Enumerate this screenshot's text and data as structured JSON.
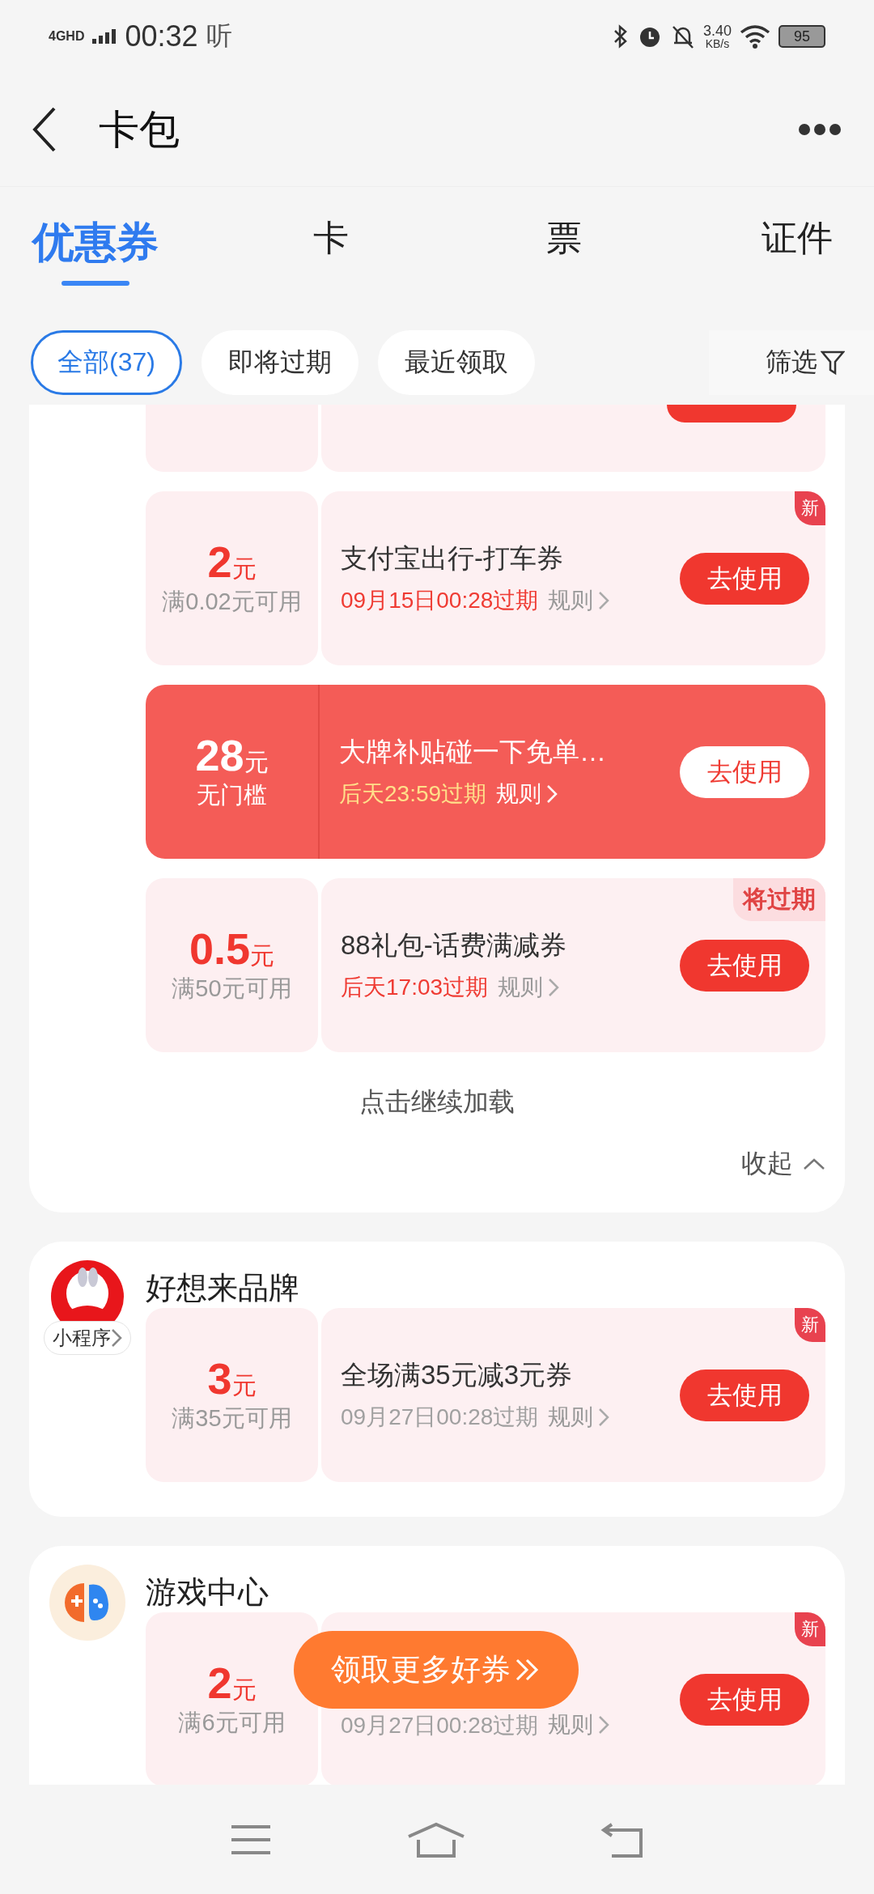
{
  "status_bar": {
    "network": "4GHD",
    "time": "00:32",
    "app_glyph": "听",
    "speed": "3.40",
    "speed_unit": "KB/s",
    "battery": "95"
  },
  "header": {
    "title": "卡包"
  },
  "tabs": [
    {
      "label": "优惠券",
      "selected": true
    },
    {
      "label": "卡",
      "selected": false
    },
    {
      "label": "票",
      "selected": false
    },
    {
      "label": "证件",
      "selected": false
    }
  ],
  "filters": [
    {
      "label": "全部(37)",
      "selected": true
    },
    {
      "label": "即将过期",
      "selected": false
    },
    {
      "label": "最近领取",
      "selected": false
    }
  ],
  "filter_button": "筛选",
  "groups": [
    {
      "coupons": [
        {
          "kind": "partial",
          "highlighted": false
        },
        {
          "kind": "full",
          "highlighted": false,
          "amount": "2",
          "unit": "元",
          "condition": "满0.02元可用",
          "title": "支付宝出行-打车券",
          "expiry": "09月15日00:28过期",
          "expiry_alert": true,
          "rule": "规则",
          "button": "去使用",
          "badge": {
            "kind": "new",
            "text": "新"
          }
        },
        {
          "kind": "full",
          "highlighted": true,
          "amount": "28",
          "unit": "元",
          "condition": "无门槛",
          "title": "大牌补贴碰一下免单…",
          "expiry": "后天23:59过期",
          "expiry_alert": true,
          "rule": "规则",
          "button": "去使用"
        },
        {
          "kind": "full",
          "highlighted": false,
          "amount": "0.5",
          "unit": "元",
          "condition": "满50元可用",
          "title": "88礼包-话费满减券",
          "expiry": "后天17:03过期",
          "expiry_alert": true,
          "rule": "规则",
          "button": "去使用",
          "badge": {
            "kind": "expiring",
            "text": "将过期"
          }
        }
      ],
      "load_more": "点击继续加载",
      "collapse": "收起"
    },
    {
      "brand": {
        "logo": {
          "kind": "rabbit"
        },
        "title": "好想来品牌",
        "tag": "小程序"
      },
      "coupons": [
        {
          "kind": "full",
          "highlighted": false,
          "amount": "3",
          "unit": "元",
          "condition": "满35元可用",
          "title": "全场满35元减3元券",
          "expiry": "09月27日00:28过期",
          "expiry_alert": false,
          "rule": "规则",
          "button": "去使用",
          "badge": {
            "kind": "new",
            "text": "新"
          }
        }
      ]
    },
    {
      "brand": {
        "logo": {
          "kind": "gamepad"
        },
        "title": "游戏中心"
      },
      "coupons": [
        {
          "kind": "full",
          "highlighted": false,
          "amount": "2",
          "unit": "元",
          "condition": "满6元可用",
          "expiry": "09月27日00:28过期",
          "expiry_alert": false,
          "rule": "规则",
          "button": "去使用",
          "badge": {
            "kind": "new",
            "text": "新"
          }
        }
      ]
    }
  ],
  "float_button": {
    "label": "领取更多好券"
  }
}
